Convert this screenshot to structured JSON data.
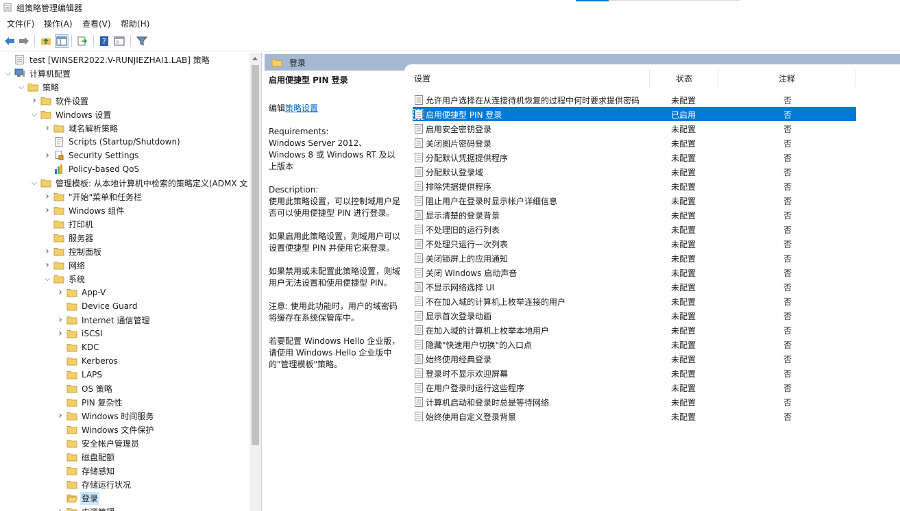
{
  "window": {
    "title": "组策略管理编辑器"
  },
  "menu": [
    "文件(F)",
    "操作(A)",
    "查看(V)",
    "帮助(H)"
  ],
  "tree": [
    {
      "label": "test [WINSER2022.V-RUNJIEZHAI1.LAB] 策略",
      "depth": 0,
      "exp": "",
      "icon": "policy-icon"
    },
    {
      "label": "计算机配置",
      "depth": 0,
      "exp": "open",
      "icon": "computer-icon"
    },
    {
      "label": "策略",
      "depth": 1,
      "exp": "open",
      "icon": "folder-icon"
    },
    {
      "label": "软件设置",
      "depth": 2,
      "exp": "closed",
      "icon": "folder-icon"
    },
    {
      "label": "Windows 设置",
      "depth": 2,
      "exp": "open",
      "icon": "folder-icon"
    },
    {
      "label": "域名解析策略",
      "depth": 3,
      "exp": "closed",
      "icon": "folder-icon"
    },
    {
      "label": "Scripts (Startup/Shutdown)",
      "depth": 3,
      "exp": "",
      "icon": "script-icon"
    },
    {
      "label": "Security Settings",
      "depth": 3,
      "exp": "closed",
      "icon": "security-icon"
    },
    {
      "label": "Policy-based QoS",
      "depth": 3,
      "exp": "",
      "icon": "qos-chart-icon"
    },
    {
      "label": "管理模板: 从本地计算机中检索的策略定义(ADMX 文",
      "depth": 2,
      "exp": "open",
      "icon": "folder-icon"
    },
    {
      "label": "\"开始\"菜单和任务栏",
      "depth": 3,
      "exp": "closed",
      "icon": "folder-icon"
    },
    {
      "label": "Windows 组件",
      "depth": 3,
      "exp": "closed",
      "icon": "folder-icon"
    },
    {
      "label": "打印机",
      "depth": 3,
      "exp": "",
      "icon": "folder-icon"
    },
    {
      "label": "服务器",
      "depth": 3,
      "exp": "",
      "icon": "folder-icon"
    },
    {
      "label": "控制面板",
      "depth": 3,
      "exp": "closed",
      "icon": "folder-icon"
    },
    {
      "label": "网络",
      "depth": 3,
      "exp": "closed",
      "icon": "folder-icon"
    },
    {
      "label": "系统",
      "depth": 3,
      "exp": "open",
      "icon": "folder-icon"
    },
    {
      "label": "App-V",
      "depth": 4,
      "exp": "closed",
      "icon": "folder-icon"
    },
    {
      "label": "Device Guard",
      "depth": 4,
      "exp": "",
      "icon": "folder-icon"
    },
    {
      "label": "Internet 通信管理",
      "depth": 4,
      "exp": "closed",
      "icon": "folder-icon"
    },
    {
      "label": "iSCSI",
      "depth": 4,
      "exp": "closed",
      "icon": "folder-icon"
    },
    {
      "label": "KDC",
      "depth": 4,
      "exp": "",
      "icon": "folder-icon"
    },
    {
      "label": "Kerberos",
      "depth": 4,
      "exp": "",
      "icon": "folder-icon"
    },
    {
      "label": "LAPS",
      "depth": 4,
      "exp": "",
      "icon": "folder-icon"
    },
    {
      "label": "OS 策略",
      "depth": 4,
      "exp": "",
      "icon": "folder-icon"
    },
    {
      "label": "PIN 复杂性",
      "depth": 4,
      "exp": "",
      "icon": "folder-icon"
    },
    {
      "label": "Windows 时间服务",
      "depth": 4,
      "exp": "closed",
      "icon": "folder-icon"
    },
    {
      "label": "Windows 文件保护",
      "depth": 4,
      "exp": "",
      "icon": "folder-icon"
    },
    {
      "label": "安全帐户管理员",
      "depth": 4,
      "exp": "",
      "icon": "folder-icon"
    },
    {
      "label": "磁盘配额",
      "depth": 4,
      "exp": "",
      "icon": "folder-icon"
    },
    {
      "label": "存储感知",
      "depth": 4,
      "exp": "",
      "icon": "folder-icon"
    },
    {
      "label": "存储运行状况",
      "depth": 4,
      "exp": "",
      "icon": "folder-icon"
    },
    {
      "label": "登录",
      "depth": 4,
      "exp": "",
      "icon": "folder-open-icon",
      "selected": true
    },
    {
      "label": "电源管理",
      "depth": 4,
      "exp": "closed",
      "icon": "folder-icon"
    }
  ],
  "right": {
    "header": "登录",
    "description": {
      "title": "启用便捷型 PIN 登录",
      "edit_prefix": "编辑",
      "edit_link": "策略设置",
      "requirements_label": "Requirements:",
      "requirements": "Windows Server 2012、Windows 8 或 Windows RT 及以上版本",
      "description_label": "Description:",
      "p1": "使用此策略设置，可以控制域用户是否可以使用便捷型 PIN 进行登录。",
      "p2": "如果启用此策略设置，则域用户可以设置便捷型 PIN 并使用它来登录。",
      "p3": "如果禁用或未配置此策略设置，则域用户无法设置和使用便捷型 PIN。",
      "p4": "注意: 使用此功能时，用户的域密码将缓存在系统保管库中。",
      "p5": "若要配置 Windows Hello 企业版，请使用 Windows Hello 企业版中的\"管理模板\"策略。"
    },
    "columns": {
      "setting": "设置",
      "state": "状态",
      "comment": "注释"
    },
    "rows": [
      {
        "name": "允许用户选择在从连接待机恢复的过程中何时要求提供密码",
        "state": "未配置",
        "comment": "否"
      },
      {
        "name": "启用便捷型 PIN 登录",
        "state": "已启用",
        "comment": "否",
        "selected": true
      },
      {
        "name": "启用安全密钥登录",
        "state": "未配置",
        "comment": "否"
      },
      {
        "name": "关闭图片密码登录",
        "state": "未配置",
        "comment": "否"
      },
      {
        "name": "分配默认凭据提供程序",
        "state": "未配置",
        "comment": "否"
      },
      {
        "name": "分配默认登录域",
        "state": "未配置",
        "comment": "否"
      },
      {
        "name": "排除凭据提供程序",
        "state": "未配置",
        "comment": "否"
      },
      {
        "name": "阻止用户在登录时显示帐户详细信息",
        "state": "未配置",
        "comment": "否"
      },
      {
        "name": "显示清楚的登录背景",
        "state": "未配置",
        "comment": "否"
      },
      {
        "name": "不处理旧的运行列表",
        "state": "未配置",
        "comment": "否"
      },
      {
        "name": "不处理只运行一次列表",
        "state": "未配置",
        "comment": "否"
      },
      {
        "name": "关闭锁屏上的应用通知",
        "state": "未配置",
        "comment": "否"
      },
      {
        "name": "关闭 Windows 启动声音",
        "state": "未配置",
        "comment": "否"
      },
      {
        "name": "不显示网络选择 UI",
        "state": "未配置",
        "comment": "否"
      },
      {
        "name": "不在加入域的计算机上枚举连接的用户",
        "state": "未配置",
        "comment": "否"
      },
      {
        "name": "显示首次登录动画",
        "state": "未配置",
        "comment": "否"
      },
      {
        "name": "在加入域的计算机上枚举本地用户",
        "state": "未配置",
        "comment": "否"
      },
      {
        "name": "隐藏\"快速用户切换\"的入口点",
        "state": "未配置",
        "comment": "否"
      },
      {
        "name": "始终使用经典登录",
        "state": "未配置",
        "comment": "否"
      },
      {
        "name": "登录时不显示欢迎屏幕",
        "state": "未配置",
        "comment": "否"
      },
      {
        "name": "在用户登录时运行这些程序",
        "state": "未配置",
        "comment": "否"
      },
      {
        "name": "计算机启动和登录时总是等待网络",
        "state": "未配置",
        "comment": "否"
      },
      {
        "name": "始终使用自定义登录背景",
        "state": "未配置",
        "comment": "否"
      }
    ]
  }
}
